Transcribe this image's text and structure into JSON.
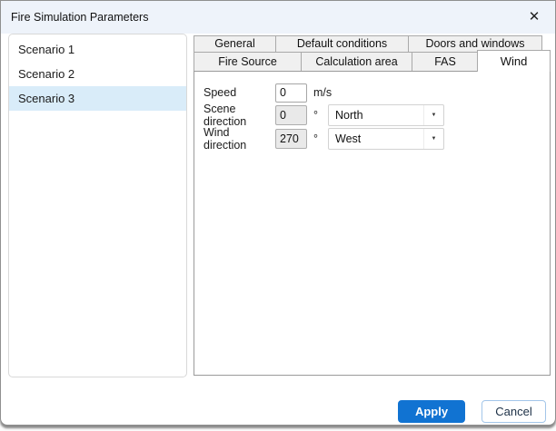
{
  "window": {
    "title": "Fire Simulation Parameters"
  },
  "icons": {
    "close": "✕",
    "dropdown_arrow": "▼"
  },
  "scenario_list": {
    "items": [
      {
        "label": "Scenario 1",
        "selected": false
      },
      {
        "label": "Scenario 2",
        "selected": false
      },
      {
        "label": "Scenario 3",
        "selected": true
      }
    ]
  },
  "tabs": {
    "row1": [
      {
        "label": "General",
        "selected": false
      },
      {
        "label": "Default conditions",
        "selected": false
      },
      {
        "label": "Doors and windows",
        "selected": false
      }
    ],
    "row2": [
      {
        "label": "Fire Source",
        "selected": false
      },
      {
        "label": "Calculation area",
        "selected": false
      },
      {
        "label": "FAS",
        "selected": false
      },
      {
        "label": "Wind",
        "selected": true
      }
    ],
    "selected_tab": "Wind"
  },
  "form": {
    "speed": {
      "label": "Speed",
      "value": "0",
      "unit": "m/s"
    },
    "scene_direction": {
      "label": "Scene direction",
      "value": "0",
      "unit": "°",
      "dropdown_value": "North"
    },
    "wind_direction": {
      "label": "Wind direction",
      "value": "270",
      "unit": "°",
      "dropdown_value": "West"
    }
  },
  "footer": {
    "apply_label": "Apply",
    "cancel_label": "Cancel"
  },
  "colors": {
    "accent_blue": "#1173d2",
    "selection_highlight": "#d9ecf9",
    "titlebar": "#eef3fa",
    "tab_inactive": "#f0f0f0"
  }
}
